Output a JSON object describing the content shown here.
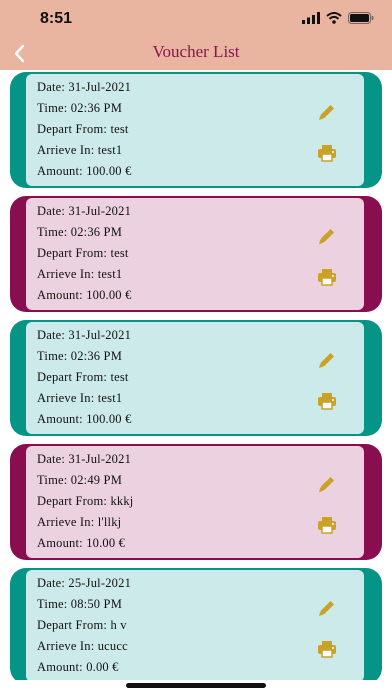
{
  "status_bar": {
    "time": "8:51"
  },
  "nav": {
    "title": "Voucher List",
    "back_icon": "chevron-left-icon"
  },
  "colors": {
    "header": "#eab5a0",
    "title": "#8a1450",
    "teal": "#069487",
    "plum": "#880e4f",
    "icon": "#c9a227"
  },
  "labels": {
    "date": "Date:",
    "time": "Time:",
    "depart": "Depart From:",
    "arrive": "Arrieve In:",
    "amount": "Amount:"
  },
  "vouchers": [
    {
      "date": "31-Jul-2021",
      "time": "02:36 PM",
      "depart": "test",
      "arrive": "test1",
      "amount": "100.00 €",
      "theme": "teal"
    },
    {
      "date": "31-Jul-2021",
      "time": "02:36 PM",
      "depart": "test",
      "arrive": "test1",
      "amount": "100.00 €",
      "theme": "plum"
    },
    {
      "date": "31-Jul-2021",
      "time": "02:36 PM",
      "depart": "test",
      "arrive": "test1",
      "amount": "100.00 €",
      "theme": "teal"
    },
    {
      "date": "31-Jul-2021",
      "time": "02:49 PM",
      "depart": "kkkj",
      "arrive": "l'llkj",
      "amount": "10.00 €",
      "theme": "plum"
    },
    {
      "date": "25-Jul-2021",
      "time": "08:50 PM",
      "depart": "h v",
      "arrive": "ucucc",
      "amount": "0.00 €",
      "theme": "teal"
    }
  ]
}
